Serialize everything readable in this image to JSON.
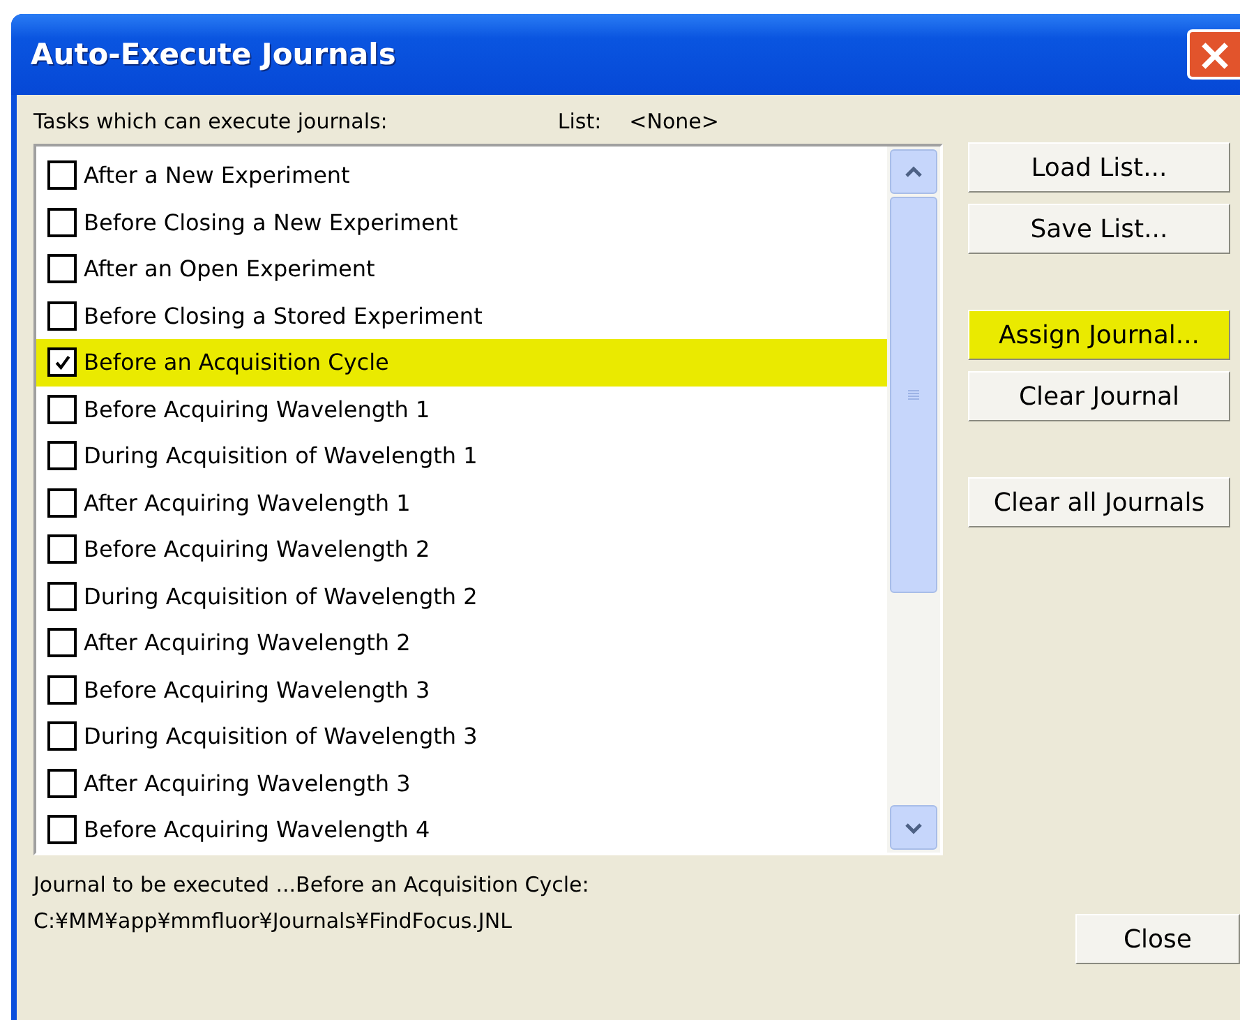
{
  "window": {
    "title": "Auto-Execute Journals",
    "close_icon": "×"
  },
  "tasks_label": "Tasks which can execute journals:",
  "list_label": "List:",
  "list_value": "<None>",
  "tasks": [
    {
      "label": "After a New Experiment",
      "checked": false,
      "selected": false
    },
    {
      "label": "Before Closing a New Experiment",
      "checked": false,
      "selected": false
    },
    {
      "label": "After an Open Experiment",
      "checked": false,
      "selected": false
    },
    {
      "label": "Before Closing a Stored Experiment",
      "checked": false,
      "selected": false
    },
    {
      "label": "Before an Acquisition Cycle",
      "checked": true,
      "selected": true
    },
    {
      "label": "Before Acquiring Wavelength 1",
      "checked": false,
      "selected": false
    },
    {
      "label": "During Acquisition of Wavelength 1",
      "checked": false,
      "selected": false
    },
    {
      "label": "After Acquiring Wavelength 1",
      "checked": false,
      "selected": false
    },
    {
      "label": "Before Acquiring Wavelength 2",
      "checked": false,
      "selected": false
    },
    {
      "label": "During Acquisition of Wavelength 2",
      "checked": false,
      "selected": false
    },
    {
      "label": "After Acquiring Wavelength 2",
      "checked": false,
      "selected": false
    },
    {
      "label": "Before Acquiring Wavelength 3",
      "checked": false,
      "selected": false
    },
    {
      "label": "During Acquisition of Wavelength 3",
      "checked": false,
      "selected": false
    },
    {
      "label": "After Acquiring Wavelength 3",
      "checked": false,
      "selected": false
    },
    {
      "label": "Before Acquiring Wavelength 4",
      "checked": false,
      "selected": false
    }
  ],
  "button_groups": [
    [
      {
        "label": "Load List...",
        "highlighted": false
      },
      {
        "label": "Save List...",
        "highlighted": false
      }
    ],
    [
      {
        "label": "Assign Journal...",
        "highlighted": true
      },
      {
        "label": "Clear Journal",
        "highlighted": false
      }
    ],
    [
      {
        "label": "Clear all Journals",
        "highlighted": false
      }
    ]
  ],
  "journal_caption": "Journal to be executed ...Before an Acquisition Cycle:",
  "journal_path": "C:¥MM¥app¥mmfluor¥Journals¥FindFocus.JNL",
  "close_button": "Close"
}
